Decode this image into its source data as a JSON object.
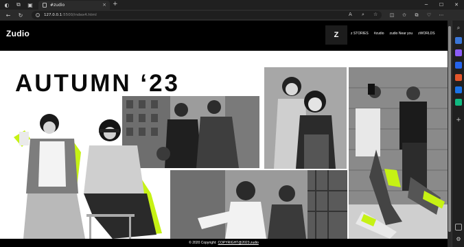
{
  "browser": {
    "tab_title": "#zudio",
    "tab_close": "×",
    "new_tab": "+",
    "address": {
      "host": "127.0.0.1",
      "path": ":5500/index4.html"
    },
    "window_controls": [
      "─",
      "☐",
      "✕"
    ]
  },
  "site": {
    "logo": "Zudio",
    "z_mark": "Z",
    "nav": [
      "z STORIES",
      "#zudio",
      "zudio Near you",
      "zWORLDS"
    ],
    "hero_title": "AUTUMN ‘23",
    "footer": {
      "prefix": "© 2020 Copyright:",
      "link": "COPYRIGHT@2023.zudio"
    }
  },
  "colors": {
    "header_bg": "#000000",
    "accent_neon": "#c6f214",
    "page_bg": "#ffffff"
  }
}
